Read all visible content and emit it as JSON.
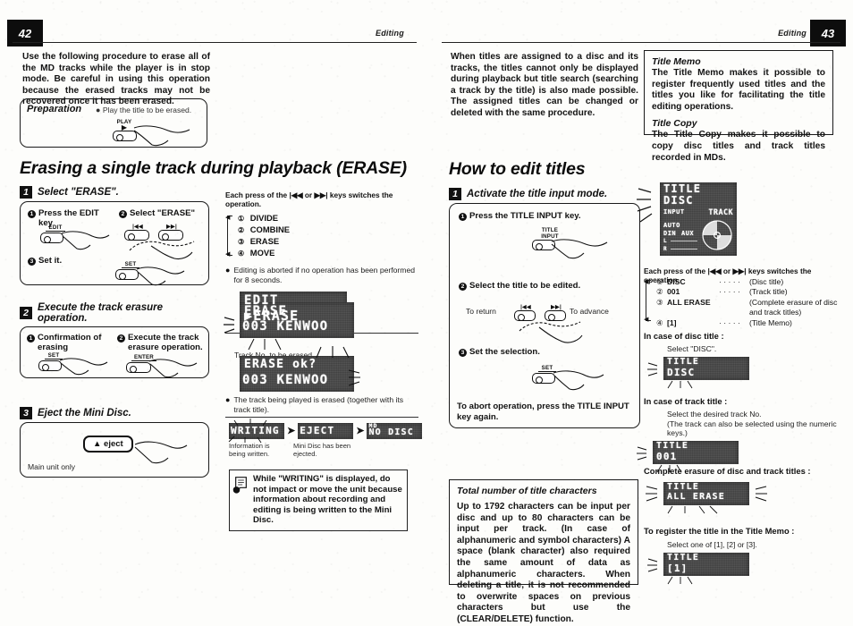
{
  "spread": {
    "left_page": {
      "number": "42",
      "running_head": "Editing",
      "intro": "Use the following procedure to erase all of the MD tracks while the player is in stop mode. Be careful in using this operation because the erased tracks may not be recovered once it has been erased.",
      "preparation": {
        "label": "Preparation",
        "note": "Play the title to be erased.",
        "key": "PLAY"
      },
      "section_title": "Erasing a single track during playback (ERASE)",
      "steps": [
        {
          "num": "1",
          "title": "Select \"ERASE\".",
          "substeps": [
            {
              "num": "1",
              "text": "Press the EDIT key",
              "key": "EDIT"
            },
            {
              "num": "2",
              "text": "Select \"ERASE\"",
              "keys": [
                "|◀◀",
                "▶▶|"
              ]
            },
            {
              "num": "3",
              "text": "Set it.",
              "key": "SET"
            }
          ]
        },
        {
          "num": "2",
          "title": "Execute the track erasure operation.",
          "substeps": [
            {
              "num": "1",
              "text": "Confirmation of erasing",
              "key": "SET"
            },
            {
              "num": "2",
              "text": "Execute the track erasure operation.",
              "key": "ENTER"
            }
          ]
        },
        {
          "num": "3",
          "title": "Eject the Mini Disc.",
          "key": "▲ eject",
          "note": "Main unit only"
        }
      ],
      "right_col": {
        "each_press": "Each press of the |◀◀ or ▶▶| keys switches the operation.",
        "options": [
          {
            "num": "①",
            "label": "DIVIDE"
          },
          {
            "num": "②",
            "label": "COMBINE"
          },
          {
            "num": "③",
            "label": "ERASE"
          },
          {
            "num": "④",
            "label": "MOVE"
          }
        ],
        "abort_note": "Editing is aborted if no operation has been performed for 8 seconds.",
        "lcd_edit": {
          "line1": "EDIT",
          "line2": "▶ERASE"
        },
        "lcd_erase1": {
          "line1": "ERASE",
          "line2": "003 KENWOO"
        },
        "track_no_caption": "Track No. to be erased",
        "lcd_erase2": {
          "line1": "ERASE   ok?",
          "line2": "003 KENWOO"
        },
        "erase_note": "The track being played is erased (together with its track title).",
        "seq": [
          {
            "text": "WRITING",
            "caption": "Information is being written."
          },
          {
            "text": "EJECT",
            "caption": "Mini Disc has been ejected."
          },
          {
            "text": "MD\nNO DISC",
            "caption": ""
          }
        ],
        "caution": "While \"WRITING\" is displayed, do not impact or move the unit because information about recording and editing is being written to the Mini Disc."
      }
    },
    "right_page": {
      "number": "43",
      "running_head": "Editing",
      "intro": "When titles are assigned to a disc and its tracks, the titles cannot only be displayed during playback but title search (searching a track by the title) is also made possible. The assigned titles can be changed or deleted with the same procedure.",
      "info_box": [
        {
          "heading": "Title Memo",
          "text": "The Title Memo makes it possible to register frequently used titles and the titles you like for facilitating the title editing operations."
        },
        {
          "heading": "Title Copy",
          "text": "The Title Copy makes it possible to copy disc titles and track titles recorded in MDs."
        }
      ],
      "section_title": "How to edit titles",
      "step": {
        "num": "1",
        "title": "Activate the title input mode.",
        "substeps": [
          {
            "num": "1",
            "text": "Press the TITLE INPUT key.",
            "key": "TITLE\nINPUT"
          },
          {
            "num": "2",
            "text": "Select the title to be edited.",
            "left_caption": "To return",
            "right_caption": "To advance",
            "keys": [
              "|◀◀",
              "▶▶|"
            ]
          },
          {
            "num": "3",
            "text": "Set the selection.",
            "key": "SET"
          }
        ],
        "abort": "To abort operation, press the TITLE INPUT key again."
      },
      "char_box": {
        "heading": "Total number of title characters",
        "text": "Up to 1792 characters can be input per disc and up to 80 characters can be input per track. (In case of alphanumeric and symbol characters) A space (blank character) also required the same amount of data as alphanumeric characters. When deleting a title, it is not recommended to overwrite spaces on previous characters but use the (CLEAR/DELETE) function."
      },
      "right_col": {
        "lcd_main": {
          "line1": "TITLE",
          "line2": "DISC",
          "input": "INPUT",
          "auto": "AUTO",
          "din": "DIN",
          "aux": "AUX",
          "l": "L",
          "r": "R",
          "track": "TRACK"
        },
        "each_press": "Each press of the |◀◀ or ▶▶| keys switches the operation.",
        "options": [
          {
            "num": "①",
            "label": "DISC",
            "dots": "· · · · ·",
            "desc": "(Disc title)"
          },
          {
            "num": "②",
            "label": "001",
            "dots": "· · · · ·",
            "desc": "(Track title)"
          },
          {
            "num": "③",
            "label": "ALL ERASE",
            "dots": "",
            "desc": "(Complete erasure of disc and track titles)"
          },
          {
            "num": "④",
            "label": "[1]",
            "dots": "· · · · ·",
            "desc": "(Title Memo)"
          }
        ],
        "cases": [
          {
            "heading": "In case of disc title :",
            "sub": [
              "Select \"DISC\"."
            ],
            "lcd": {
              "line1": "TITLE",
              "line2": "DISC"
            }
          },
          {
            "heading": "In case of track title :",
            "sub": [
              "Select the desired track No.",
              "(The track can also be selected using the numeric keys.)"
            ],
            "lcd": {
              "line1": "TITLE",
              "line2": "001"
            }
          },
          {
            "heading": "Complete erasure of disc and track titles :",
            "sub": [],
            "lcd": {
              "line1": "TITLE",
              "line2": "ALL ERASE"
            }
          },
          {
            "heading": "To register the title in the Title Memo :",
            "sub": [
              "Select one of [1], [2] or [3]."
            ],
            "lcd": {
              "line1": "TITLE",
              "line2": "[1]"
            }
          }
        ]
      }
    }
  }
}
